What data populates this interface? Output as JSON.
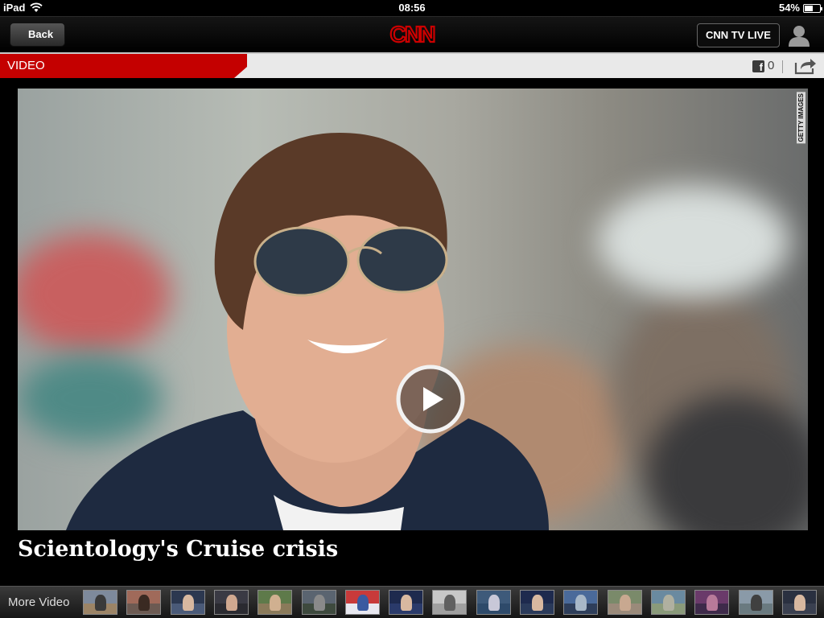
{
  "status_bar": {
    "device": "iPad",
    "time": "08:56",
    "battery": "54%",
    "battery_level": 0.54
  },
  "nav": {
    "back_label": "Back",
    "logo_text": "CNN",
    "live_label": "CNN TV LIVE"
  },
  "section": {
    "label": "VIDEO",
    "like_count": "0"
  },
  "video": {
    "credit": "GETTY IMAGES",
    "title": "Scientology's Cruise crisis"
  },
  "filmstrip": {
    "label": "More Video",
    "thumbnail_count": 17
  },
  "colors": {
    "brand_red": "#c40000",
    "logo_red": "#cc0000",
    "section_bg": "#e9e9e9"
  }
}
